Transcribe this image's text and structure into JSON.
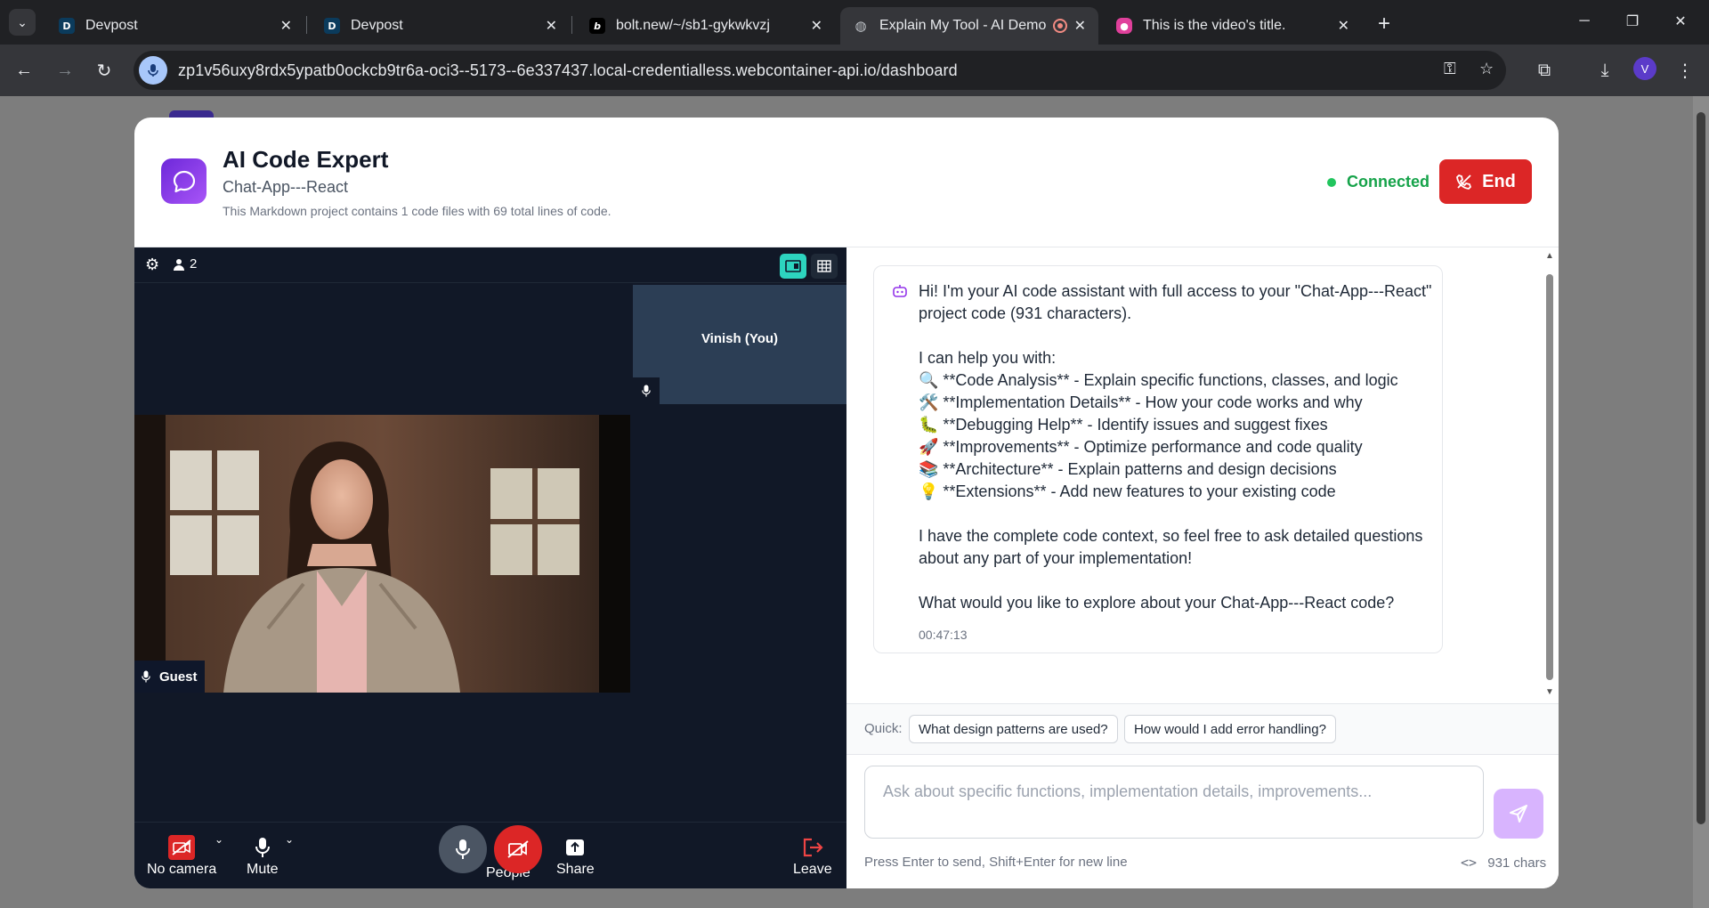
{
  "browser": {
    "tabs": [
      {
        "title": "Devpost",
        "favicon": "D"
      },
      {
        "title": "Devpost",
        "favicon": "D"
      },
      {
        "title": "bolt.new/~/sb1-gykwkvzj",
        "favicon": "b"
      },
      {
        "title": "Explain My Tool - AI Demo",
        "favicon": "globe"
      },
      {
        "title": "This is the video's title.",
        "favicon": "rec"
      }
    ],
    "url": "zp1v56uxy8rdx5ypatb0ockcb9tr6a-oci3--5173--6e337437.local-credentialless.webcontainer-api.io/dashboard",
    "profile_initial": "V"
  },
  "modal": {
    "title": "AI Code Expert",
    "subtitle": "Chat-App---React",
    "description": "This Markdown project contains 1 code files with 69 total lines of code.",
    "status": "Connected",
    "end_label": "End"
  },
  "video": {
    "participant_count": "2",
    "you_label": "Vinish (You)",
    "guest_label": "Guest",
    "controls": {
      "camera": "No camera",
      "mute": "Mute",
      "people": "People",
      "share": "Share",
      "leave": "Leave"
    }
  },
  "chat": {
    "message": "Hi! I'm your AI code assistant with full access to your \"Chat-App---React\" project code (931 characters).\n\nI can help you with:\n🔍 **Code Analysis** - Explain specific functions, classes, and logic\n🛠️ **Implementation Details** - How your code works and why\n🐛 **Debugging Help** - Identify issues and suggest fixes\n🚀 **Improvements** - Optimize performance and code quality\n📚 **Architecture** - Explain patterns and design decisions\n💡 **Extensions** - Add new features to your existing code\n\nI have the complete code context, so feel free to ask detailed questions about any part of your implementation!\n\nWhat would you like to explore about your Chat-App---React code?",
    "timestamp": "00:47:13",
    "quick_label": "Quick:",
    "quick_questions": [
      "What design patterns are used?",
      "How would I add error handling?"
    ],
    "input_placeholder": "Ask about specific functions, implementation details, improvements...",
    "hint": "Press Enter to send, Shift+Enter for new line",
    "char_count": "931 chars"
  },
  "colors": {
    "accent": "#7c3aed",
    "connected": "#16a34a",
    "end": "#dc2626",
    "layout_active": "#2dd4bf"
  }
}
